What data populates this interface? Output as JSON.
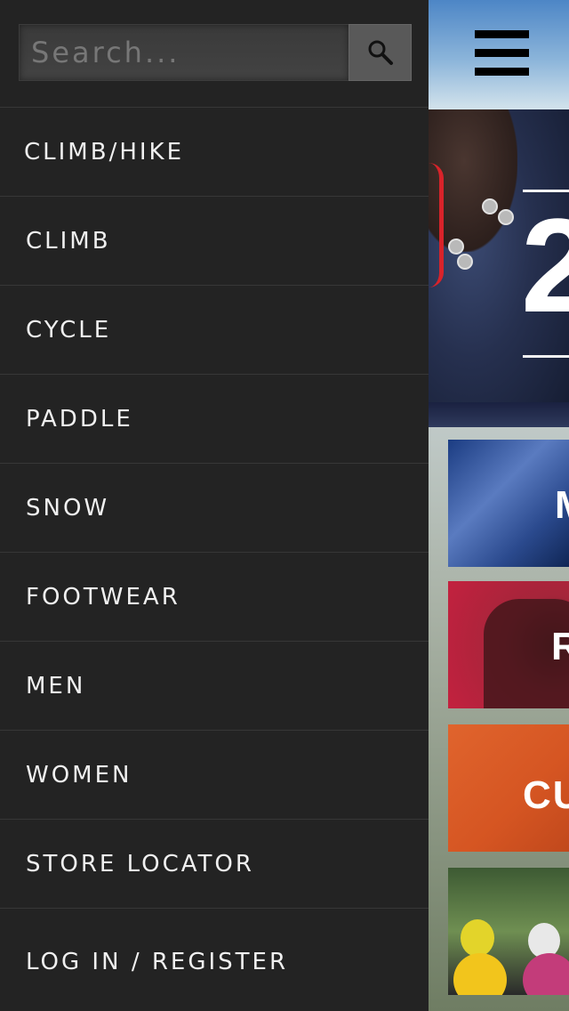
{
  "search": {
    "placeholder": "Search...",
    "icon": "search-icon"
  },
  "menu": {
    "items": [
      {
        "label": "CLIMB/HIKE"
      },
      {
        "label": "CLIMB"
      },
      {
        "label": "CYCLE"
      },
      {
        "label": "PADDLE"
      },
      {
        "label": "SNOW"
      },
      {
        "label": "FOOTWEAR"
      },
      {
        "label": "MEN"
      },
      {
        "label": "WOMEN"
      },
      {
        "label": "STORE LOCATOR"
      },
      {
        "label": "LOG IN / REGISTER"
      }
    ]
  },
  "main": {
    "menu_icon": "hamburger-menu-icon",
    "hero": {
      "number_fragment": "2"
    },
    "tiles": [
      {
        "label_fragment": "M"
      },
      {
        "label_fragment": "R"
      },
      {
        "label_fragment": "CU"
      },
      {
        "label_fragment": ""
      }
    ]
  },
  "colors": {
    "drawer_bg": "#232323",
    "divider": "#373737",
    "menu_text": "#f0f0f0",
    "search_button_bg": "#595959",
    "tile_red": "#c3213f",
    "tile_orange": "#d55522",
    "tile_blue": "#2b4a8e"
  }
}
